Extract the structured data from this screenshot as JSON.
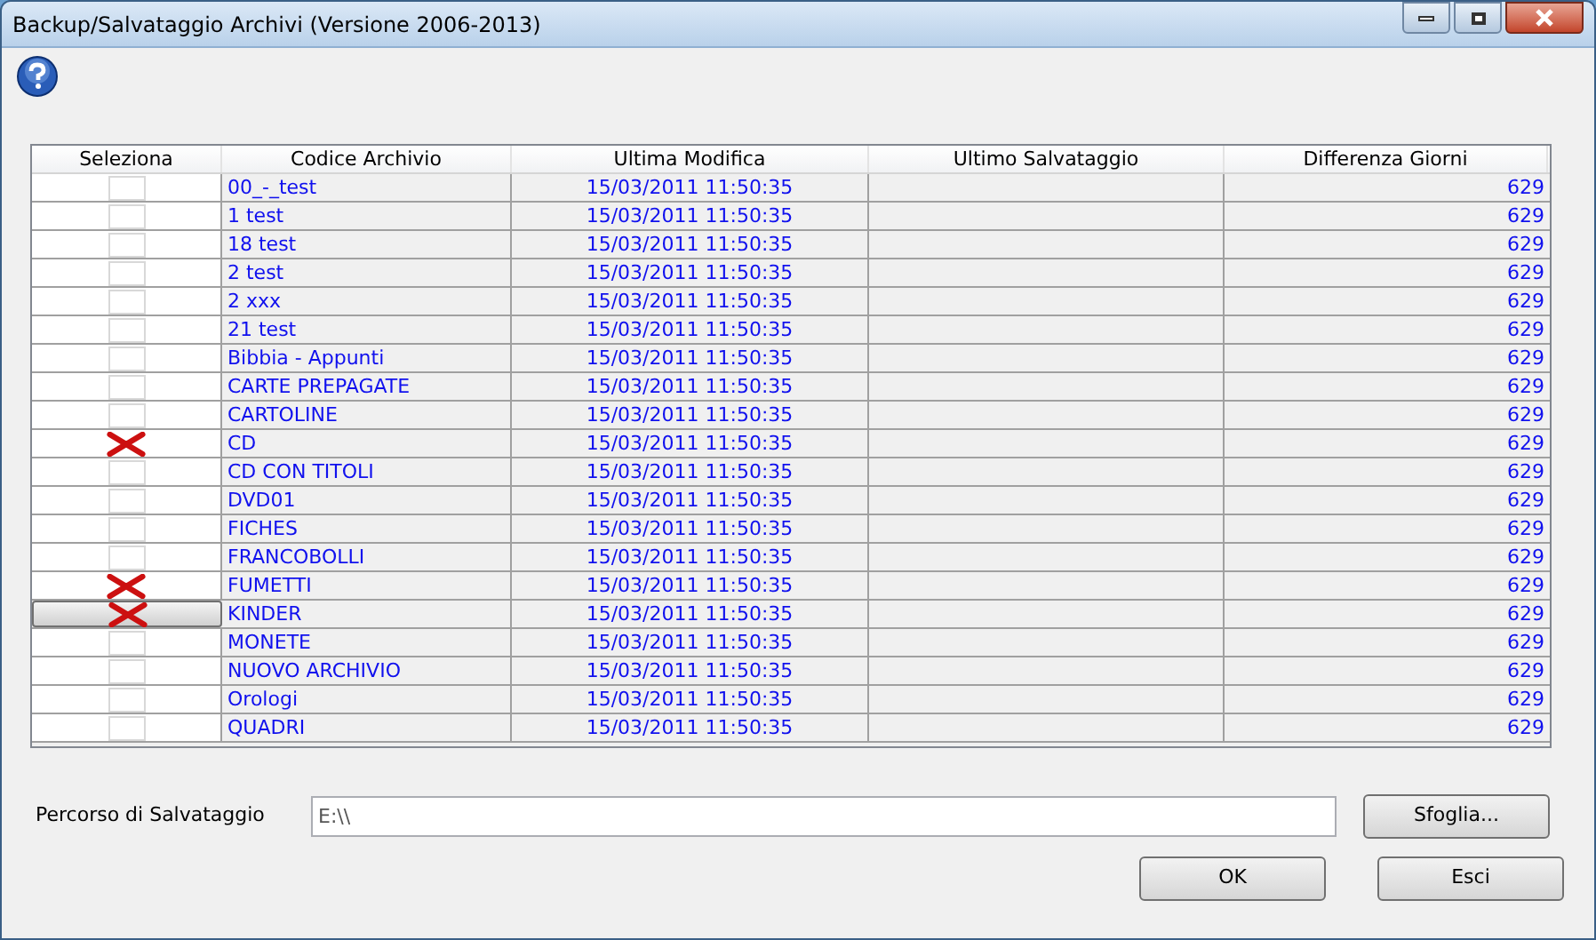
{
  "window": {
    "title": "Backup/Salvataggio Archivi (Versione 2006-2013)"
  },
  "table": {
    "columns": [
      "Seleziona",
      "Codice Archivio",
      "Ultima Modifica",
      "Ultimo Salvataggio",
      "Differenza Giorni"
    ],
    "rows": [
      {
        "checked": false,
        "selected": false,
        "code": "00_-_test",
        "modified": "15/03/2011 11:50:35",
        "days": "629"
      },
      {
        "checked": false,
        "selected": false,
        "code": "1 test",
        "modified": "15/03/2011 11:50:35",
        "days": "629"
      },
      {
        "checked": false,
        "selected": false,
        "code": "18 test",
        "modified": "15/03/2011 11:50:35",
        "days": "629"
      },
      {
        "checked": false,
        "selected": false,
        "code": "2 test",
        "modified": "15/03/2011 11:50:35",
        "days": "629"
      },
      {
        "checked": false,
        "selected": false,
        "code": "2 xxx",
        "modified": "15/03/2011 11:50:35",
        "days": "629"
      },
      {
        "checked": false,
        "selected": false,
        "code": "21 test",
        "modified": "15/03/2011 11:50:35",
        "days": "629"
      },
      {
        "checked": false,
        "selected": false,
        "code": "Bibbia - Appunti",
        "modified": "15/03/2011 11:50:35",
        "days": "629"
      },
      {
        "checked": false,
        "selected": false,
        "code": "CARTE PREPAGATE",
        "modified": "15/03/2011 11:50:35",
        "days": "629"
      },
      {
        "checked": false,
        "selected": false,
        "code": "CARTOLINE",
        "modified": "15/03/2011 11:50:35",
        "days": "629"
      },
      {
        "checked": true,
        "selected": false,
        "code": "CD",
        "modified": "15/03/2011 11:50:35",
        "days": "629"
      },
      {
        "checked": false,
        "selected": false,
        "code": "CD CON TITOLI",
        "modified": "15/03/2011 11:50:35",
        "days": "629"
      },
      {
        "checked": false,
        "selected": false,
        "code": "DVD01",
        "modified": "15/03/2011 11:50:35",
        "days": "629"
      },
      {
        "checked": false,
        "selected": false,
        "code": "FICHES",
        "modified": "15/03/2011 11:50:35",
        "days": "629"
      },
      {
        "checked": false,
        "selected": false,
        "code": "FRANCOBOLLI",
        "modified": "15/03/2011 11:50:35",
        "days": "629"
      },
      {
        "checked": true,
        "selected": false,
        "code": "FUMETTI",
        "modified": "15/03/2011 11:50:35",
        "days": "629"
      },
      {
        "checked": true,
        "selected": true,
        "code": "KINDER",
        "modified": "15/03/2011 11:50:35",
        "days": "629"
      },
      {
        "checked": false,
        "selected": false,
        "code": "MONETE",
        "modified": "15/03/2011 11:50:35",
        "days": "629"
      },
      {
        "checked": false,
        "selected": false,
        "code": "NUOVO ARCHIVIO",
        "modified": "15/03/2011 11:50:35",
        "days": "629"
      },
      {
        "checked": false,
        "selected": false,
        "code": "Orologi",
        "modified": "15/03/2011 11:50:35",
        "days": "629"
      },
      {
        "checked": false,
        "selected": false,
        "code": "QUADRI",
        "modified": "15/03/2011 11:50:35",
        "days": "629"
      }
    ]
  },
  "path": {
    "label": "Percorso di Salvataggio",
    "value": "E:\\\\",
    "browse": "Sfoglia..."
  },
  "buttons": [
    "OK",
    "Esci"
  ]
}
